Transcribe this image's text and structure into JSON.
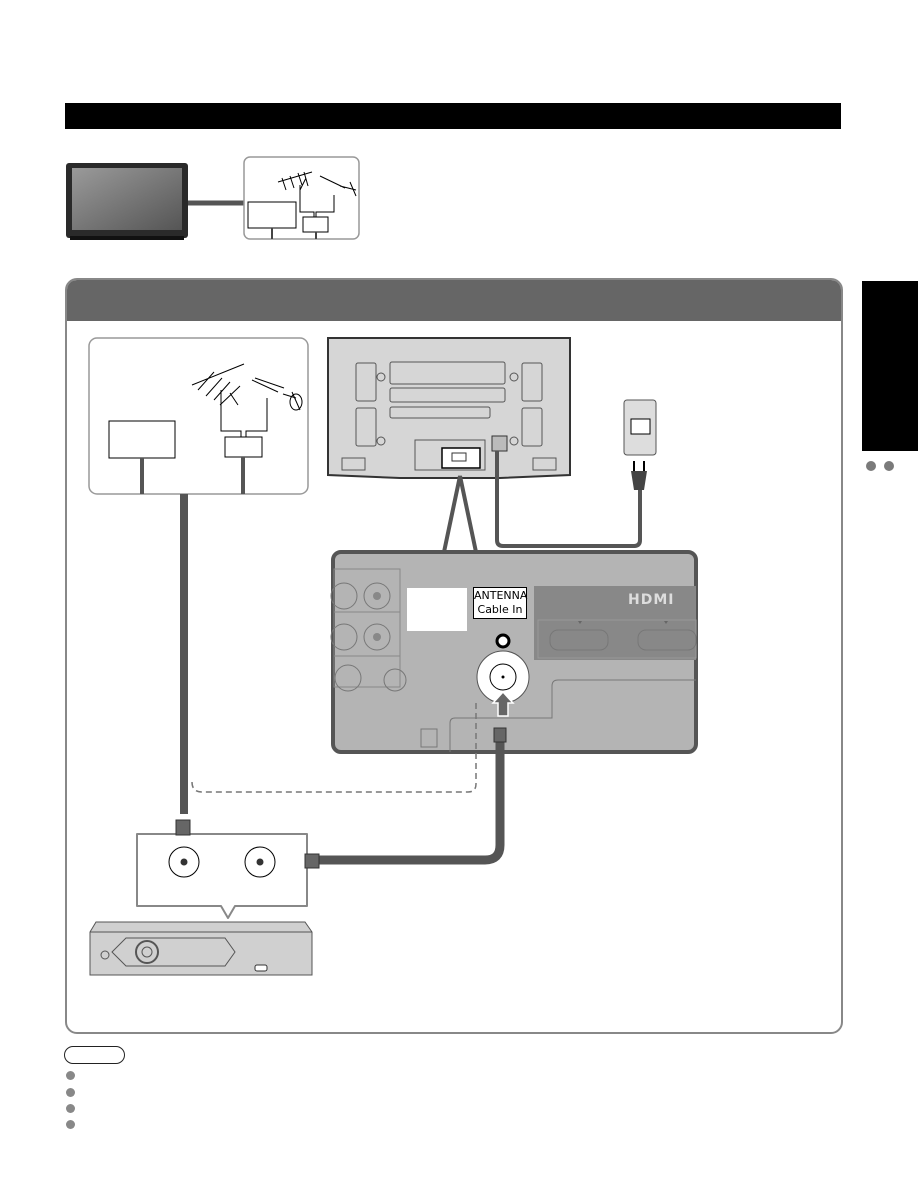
{
  "page": {
    "header_bar": "",
    "side_tab": "",
    "side_dots": 2
  },
  "overview_diagram": {
    "items": [
      "tv-front",
      "antenna-box"
    ]
  },
  "connection_panel": {
    "header": "",
    "tv_terminal": {
      "antenna_label_line1": "ANTENNA",
      "antenna_label_line2": "Cable In",
      "hdmi_logo": "HDMI"
    }
  },
  "notes": {
    "badge": "",
    "bullet_count": 4
  },
  "colors": {
    "bar": "#000000",
    "panel_header": "#666666",
    "cable": "#555555",
    "terminal_panel": "#b4b4b4",
    "border": "#888888"
  }
}
